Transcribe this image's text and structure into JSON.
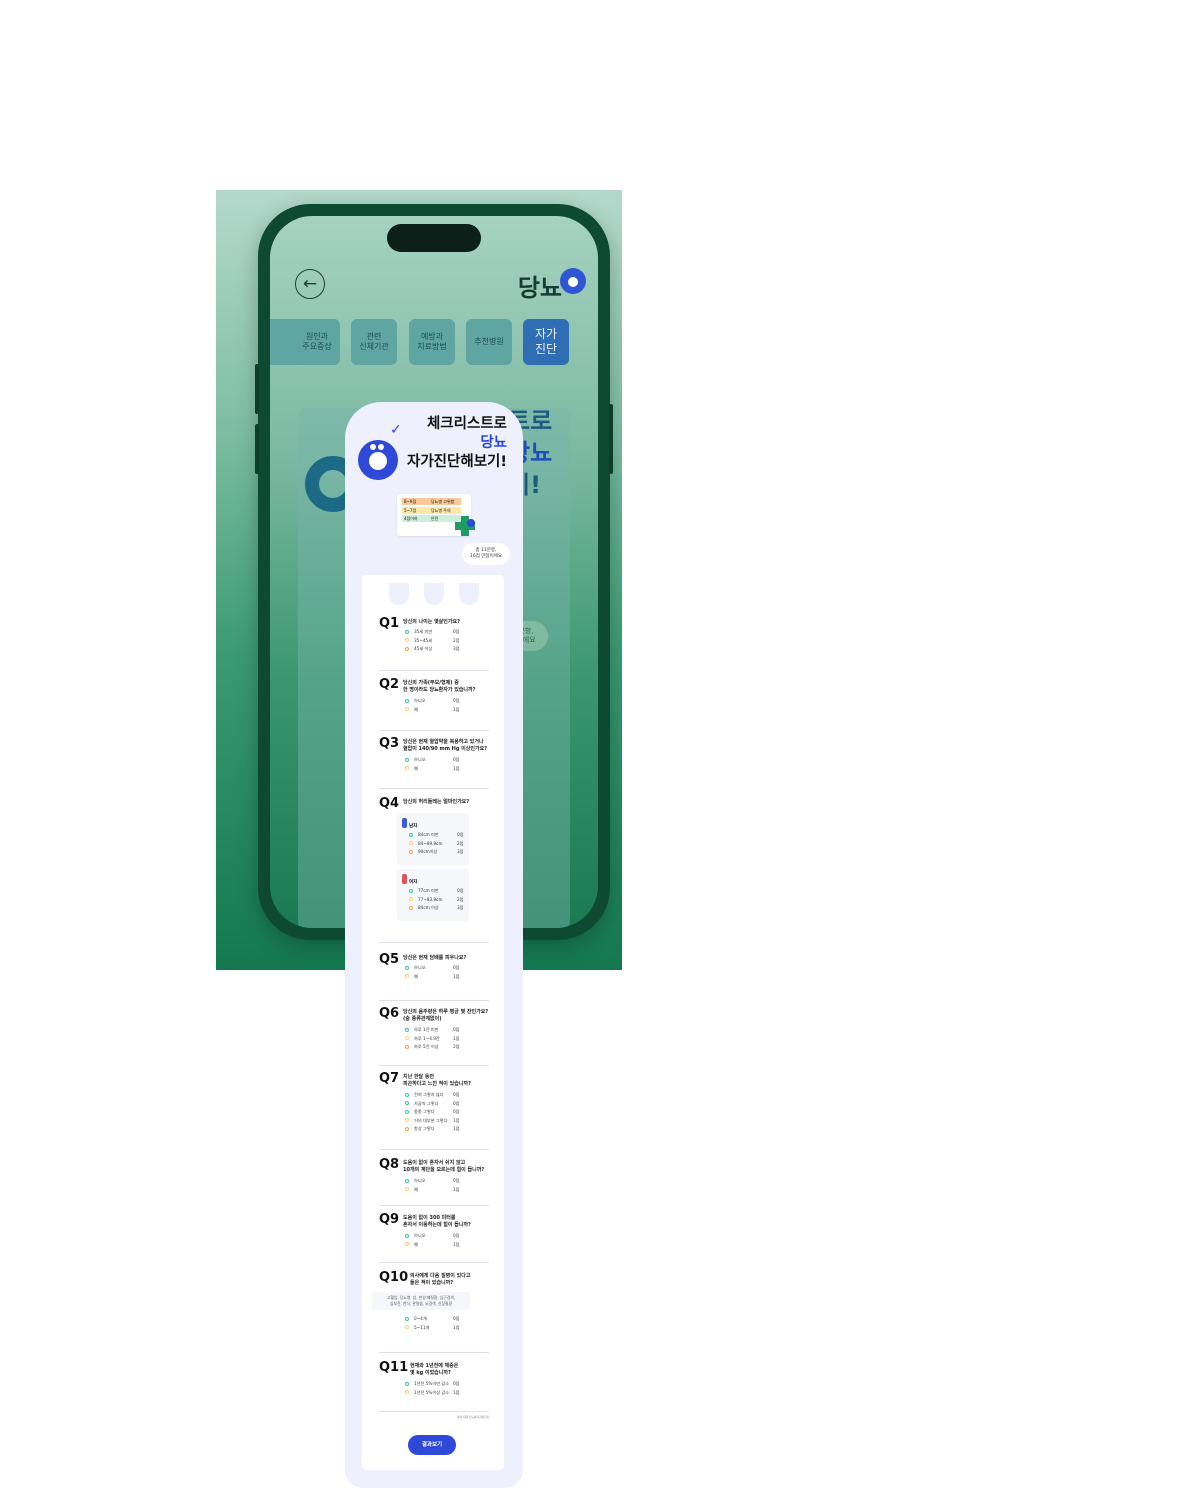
{
  "app": {
    "title": "당뇨",
    "back_icon": "arrow-left-icon",
    "tabs": [
      {
        "label": "원인과\n주요증상",
        "active": false
      },
      {
        "label": "관련\n신체기관",
        "active": false
      },
      {
        "label": "예방과\n치료방법",
        "active": false
      },
      {
        "label": "추천병원",
        "active": false
      },
      {
        "label": "자가\n진단",
        "active": true
      }
    ],
    "ghost_heading": [
      "트로",
      "당뇨",
      "기!"
    ],
    "ghost_bubble": "문항,\n이에요",
    "accent": "#2e48d8",
    "tab_active_color": "#2f6db5"
  },
  "intro": {
    "line1": "체크리스트로",
    "line2": "당뇨",
    "line3": "자가진단해보기!",
    "table_rows": [
      {
        "range": "8~9점",
        "status": "당뇨병 고위험",
        "color": "#f9c99a"
      },
      {
        "range": "5~7점",
        "status": "당뇨병 주의",
        "color": "#fbe7a8"
      },
      {
        "range": "4점이하",
        "status": "안전",
        "color": "#cdeedd"
      }
    ],
    "bubble": "총 11문항,\n16점 만점이에요"
  },
  "questions": [
    {
      "num": "Q1",
      "text": "당신의 나이는 몇살인가요?",
      "options": [
        {
          "label": "35세 미만",
          "score": "0점",
          "tone": "g"
        },
        {
          "label": "35~45세",
          "score": "2점",
          "tone": "y"
        },
        {
          "label": "45세 이상",
          "score": "3점",
          "tone": "o"
        }
      ]
    },
    {
      "num": "Q2",
      "text": "당신의 가족(부모/형제) 중\n한 명이라도 당뇨환자가 있습니까?",
      "options": [
        {
          "label": "아니오",
          "score": "0점",
          "tone": "g"
        },
        {
          "label": "예",
          "score": "1점",
          "tone": "y"
        }
      ]
    },
    {
      "num": "Q3",
      "text": "당신은 현재 혈압약을 복용하고 있거나\n혈압이 140/90 mm Hg 이상인가요?",
      "options": [
        {
          "label": "아니오",
          "score": "0점",
          "tone": "g"
        },
        {
          "label": "예",
          "score": "1점",
          "tone": "y"
        }
      ]
    },
    {
      "num": "Q4",
      "text": "당신의 허리둘레는 얼마인가요?",
      "groups": [
        {
          "label": "남자",
          "icon_color": "#3b5be0",
          "options": [
            {
              "label": "84cm 미만",
              "score": "0점",
              "tone": "g"
            },
            {
              "label": "84~89.9cm",
              "score": "2점",
              "tone": "y"
            },
            {
              "label": "90cm이상",
              "score": "3점",
              "tone": "o"
            }
          ]
        },
        {
          "label": "여자",
          "icon_color": "#e0525a",
          "options": [
            {
              "label": "77cm 미만",
              "score": "0점",
              "tone": "g"
            },
            {
              "label": "77~83.9cm",
              "score": "2점",
              "tone": "y"
            },
            {
              "label": "84cm 이상",
              "score": "3점",
              "tone": "o"
            }
          ]
        }
      ]
    },
    {
      "num": "Q5",
      "text": "당신은 현재 담배를 피우나요?",
      "options": [
        {
          "label": "아니오",
          "score": "0점",
          "tone": "g"
        },
        {
          "label": "예",
          "score": "1점",
          "tone": "y"
        }
      ]
    },
    {
      "num": "Q6",
      "text": "당신의 음주량은 하루 평균 몇 잔인가요?\n(술 종류관계없이)",
      "options": [
        {
          "label": "하루 1잔 미만",
          "score": "0점",
          "tone": "g"
        },
        {
          "label": "하루 1~4.9잔",
          "score": "1점",
          "tone": "y"
        },
        {
          "label": "하루 5잔 이상",
          "score": "2점",
          "tone": "o"
        }
      ]
    },
    {
      "num": "Q7",
      "text": "지난 한달 동안\n피곤하다고 느낀 적이 있습니까?",
      "options": [
        {
          "label": "전혀 그렇지 않다",
          "score": "0점",
          "tone": "g"
        },
        {
          "label": "가끔씩 그렇다",
          "score": "0점",
          "tone": "g"
        },
        {
          "label": "종종 그렇다",
          "score": "0점",
          "tone": "g"
        },
        {
          "label": "거의 대부분 그렇다",
          "score": "1점",
          "tone": "y"
        },
        {
          "label": "항상 그렇다",
          "score": "1점",
          "tone": "o"
        }
      ]
    },
    {
      "num": "Q8",
      "text": "도움이 없이 혼자서 쉬지 않고\n10개의 계단을 오르는데 힘이 듭니까?",
      "options": [
        {
          "label": "아니오",
          "score": "0점",
          "tone": "g"
        },
        {
          "label": "예",
          "score": "1점",
          "tone": "y"
        }
      ]
    },
    {
      "num": "Q9",
      "text": "도움이 없이 300 미터를\n혼자서 이동하는데 힘이 듭니까?",
      "options": [
        {
          "label": "아니오",
          "score": "0점",
          "tone": "g"
        },
        {
          "label": "예",
          "score": "1점",
          "tone": "y"
        }
      ]
    },
    {
      "num": "Q10",
      "text": "의사에게 다음 질병이 있다고\n들은 적이 있습니까?",
      "note": "고혈압, 당뇨병, 암, 만성 폐질환, 심근경색,\n심부전, 천식, 관절염, 뇌경색, 신장질환",
      "options": [
        {
          "label": "0~4개",
          "score": "0점",
          "tone": "g"
        },
        {
          "label": "5~11개",
          "score": "1점",
          "tone": "y"
        }
      ]
    },
    {
      "num": "Q11",
      "text": "현재와 1년전에 체중은\n몇 kg 이었습니까?",
      "options": [
        {
          "label": "1년전 5%이만 감소",
          "score": "0점",
          "tone": "g"
        },
        {
          "label": "1년전 5%이상 감소",
          "score": "1점",
          "tone": "y"
        }
      ]
    }
  ],
  "source": "출처: 대한 당뇨병 자가진단표",
  "result_button": "결과보기"
}
